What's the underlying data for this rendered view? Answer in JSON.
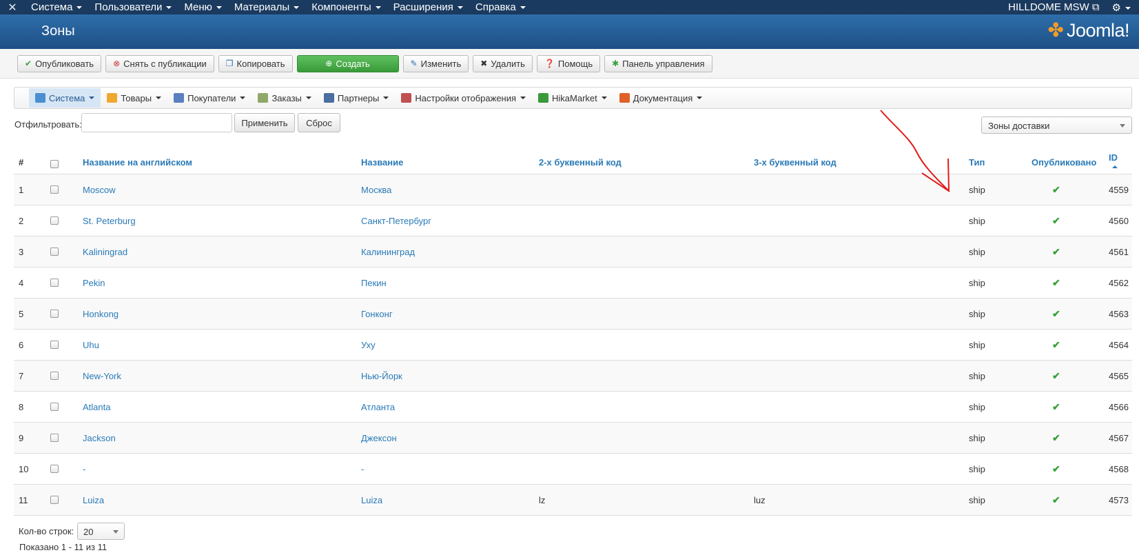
{
  "topnav": {
    "menu": [
      "Система",
      "Пользователи",
      "Меню",
      "Материалы",
      "Компоненты",
      "Расширения",
      "Справка"
    ],
    "site": "HILLDOME MSW"
  },
  "header": {
    "title": "Зоны",
    "brand": "Joomla!"
  },
  "toolbar": {
    "publish": "Опубликовать",
    "unpublish": "Снять с публикации",
    "copy": "Копировать",
    "create": "Создать",
    "edit": "Изменить",
    "delete": "Удалить",
    "help": "Помощь",
    "panel": "Панель управления"
  },
  "compmenu": [
    {
      "label": "Система",
      "icon": "system-icon",
      "color": "#4a8fd1"
    },
    {
      "label": "Товары",
      "icon": "products-icon",
      "color": "#f0a830"
    },
    {
      "label": "Покупатели",
      "icon": "customers-icon",
      "color": "#5b7fc0"
    },
    {
      "label": "Заказы",
      "icon": "orders-icon",
      "color": "#8fa86a"
    },
    {
      "label": "Партнеры",
      "icon": "partners-icon",
      "color": "#4a6fa0"
    },
    {
      "label": "Настройки отображения",
      "icon": "display-icon",
      "color": "#c05050"
    },
    {
      "label": "HikaMarket",
      "icon": "hikamarket-icon",
      "color": "#3a9a3a"
    },
    {
      "label": "Документация",
      "icon": "docs-icon",
      "color": "#e0602a"
    }
  ],
  "filter": {
    "label": "Отфильтровать:",
    "value": "",
    "apply": "Применить",
    "reset": "Сброс",
    "zone_type": "Зоны доставки"
  },
  "table": {
    "headers": {
      "num": "#",
      "name_en": "Название на английском",
      "name": "Название",
      "code2": "2-х буквенный код",
      "code3": "3-х буквенный код",
      "type": "Тип",
      "published": "Опубликовано",
      "id": "ID"
    },
    "rows": [
      {
        "num": "1",
        "name_en": "Moscow",
        "name": "Москва",
        "code2": "",
        "code3": "",
        "type": "ship",
        "id": "4559"
      },
      {
        "num": "2",
        "name_en": "St. Peterburg",
        "name": "Санкт-Петербург",
        "code2": "",
        "code3": "",
        "type": "ship",
        "id": "4560"
      },
      {
        "num": "3",
        "name_en": "Kaliningrad",
        "name": "Калининград",
        "code2": "",
        "code3": "",
        "type": "ship",
        "id": "4561"
      },
      {
        "num": "4",
        "name_en": "Pekin",
        "name": "Пекин",
        "code2": "",
        "code3": "",
        "type": "ship",
        "id": "4562"
      },
      {
        "num": "5",
        "name_en": "Honkong",
        "name": "Гонконг",
        "code2": "",
        "code3": "",
        "type": "ship",
        "id": "4563"
      },
      {
        "num": "6",
        "name_en": "Uhu",
        "name": "Уху",
        "code2": "",
        "code3": "",
        "type": "ship",
        "id": "4564"
      },
      {
        "num": "7",
        "name_en": "New-York",
        "name": "Нью-Йорк",
        "code2": "",
        "code3": "",
        "type": "ship",
        "id": "4565"
      },
      {
        "num": "8",
        "name_en": "Atlanta",
        "name": "Атланта",
        "code2": "",
        "code3": "",
        "type": "ship",
        "id": "4566"
      },
      {
        "num": "9",
        "name_en": "Jackson",
        "name": "Джексон",
        "code2": "",
        "code3": "",
        "type": "ship",
        "id": "4567"
      },
      {
        "num": "10",
        "name_en": "-",
        "name": "-",
        "code2": "",
        "code3": "",
        "type": "ship",
        "id": "4568"
      },
      {
        "num": "11",
        "name_en": "Luiza",
        "name": "Luiza",
        "code2": "lz",
        "code3": "luz",
        "type": "ship",
        "id": "4573"
      }
    ]
  },
  "footer": {
    "rows_label": "Кол-во строк:",
    "rows_value": "20",
    "shown": "Показано 1 - 11 из 11"
  },
  "colors": {
    "nav_bg": "#1b3a5f",
    "header_bg": "#2e6eaa",
    "link": "#2a7ab7",
    "create_btn": "#3a9a3a",
    "check": "#3aa03a",
    "annotation_arrow": "#e21b1b"
  }
}
